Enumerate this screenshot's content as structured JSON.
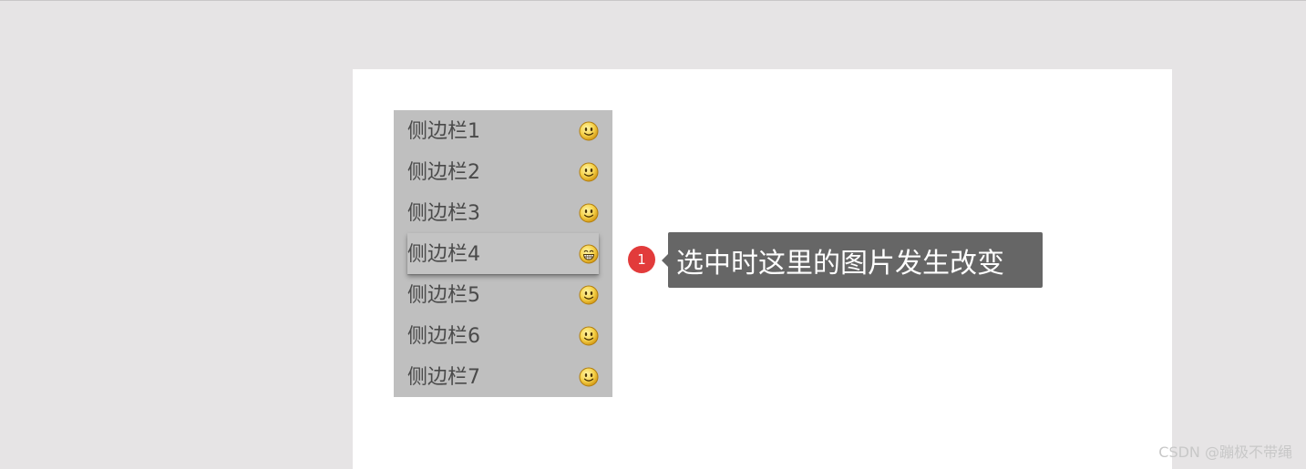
{
  "sidebar": {
    "items": [
      {
        "label": "侧边栏1",
        "icon": "smile-face-icon",
        "active": false
      },
      {
        "label": "侧边栏2",
        "icon": "smile-face-icon",
        "active": false
      },
      {
        "label": "侧边栏3",
        "icon": "smile-face-icon",
        "active": false
      },
      {
        "label": "侧边栏4",
        "icon": "grin-face-icon",
        "active": true
      },
      {
        "label": "侧边栏5",
        "icon": "smile-face-icon",
        "active": false
      },
      {
        "label": "侧边栏6",
        "icon": "smile-face-icon",
        "active": false
      },
      {
        "label": "侧边栏7",
        "icon": "smile-face-icon",
        "active": false
      }
    ]
  },
  "annotation": {
    "badge_number": "1",
    "text": "选中时这里的图片发生改变"
  },
  "watermark": {
    "text": "CSDN @蹦极不带绳"
  },
  "colors": {
    "page_background": "#e6e4e5",
    "canvas_background": "#ffffff",
    "sidebar_background": "#bfbfbf",
    "badge": "#e23b3b",
    "callout_background": "#666666"
  }
}
